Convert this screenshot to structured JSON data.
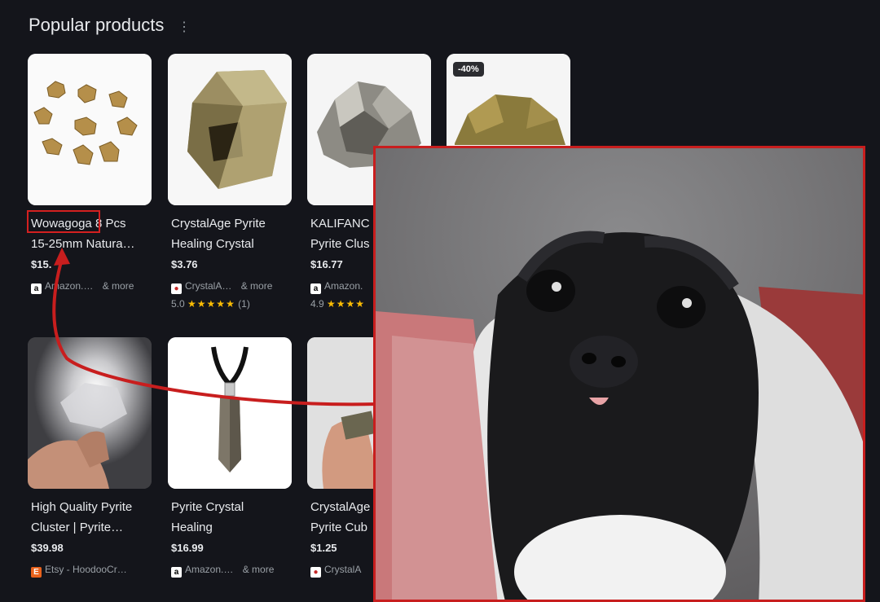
{
  "section": {
    "title": "Popular products"
  },
  "products": [
    {
      "title_line1": "Wowagoga 8 Pcs",
      "title_line2": "15-25mm Natura…",
      "price": "$15.",
      "seller": "Amazon.…",
      "more": "& more",
      "rating": "",
      "stars": "",
      "count": ""
    },
    {
      "title_line1": "CrystalAge Pyrite",
      "title_line2": "Healing Crystal",
      "price": "$3.76",
      "seller": "CrystalA…",
      "more": "& more",
      "rating": "5.0",
      "stars": "★★★★★",
      "count": "(1)"
    },
    {
      "title_line1": "KALIFANC",
      "title_line2": "Pyrite Clus",
      "price": "$16.77",
      "seller": "Amazon.",
      "more": "",
      "rating": "4.9",
      "stars": "★★★★",
      "count": "",
      "badge": "-40%"
    },
    {
      "title_line1": "High Quality Pyrite",
      "title_line2": "Cluster | Pyrite…",
      "price": "$39.98",
      "seller": "Etsy - HoodooCr…",
      "more": "",
      "rating": "",
      "stars": "",
      "count": ""
    },
    {
      "title_line1": "Pyrite Crystal",
      "title_line2": "Healing",
      "price": "$16.99",
      "seller": "Amazon.…",
      "more": "& more",
      "rating": "",
      "stars": "",
      "count": ""
    },
    {
      "title_line1": "CrystalAge",
      "title_line2": "Pyrite Cub",
      "price": "$1.25",
      "seller": "CrystalA",
      "more": "",
      "rating": "",
      "stars": "",
      "count": ""
    }
  ],
  "overlay_colors": {
    "frame": "#c81e1e",
    "arrow": "#c81e1e"
  }
}
